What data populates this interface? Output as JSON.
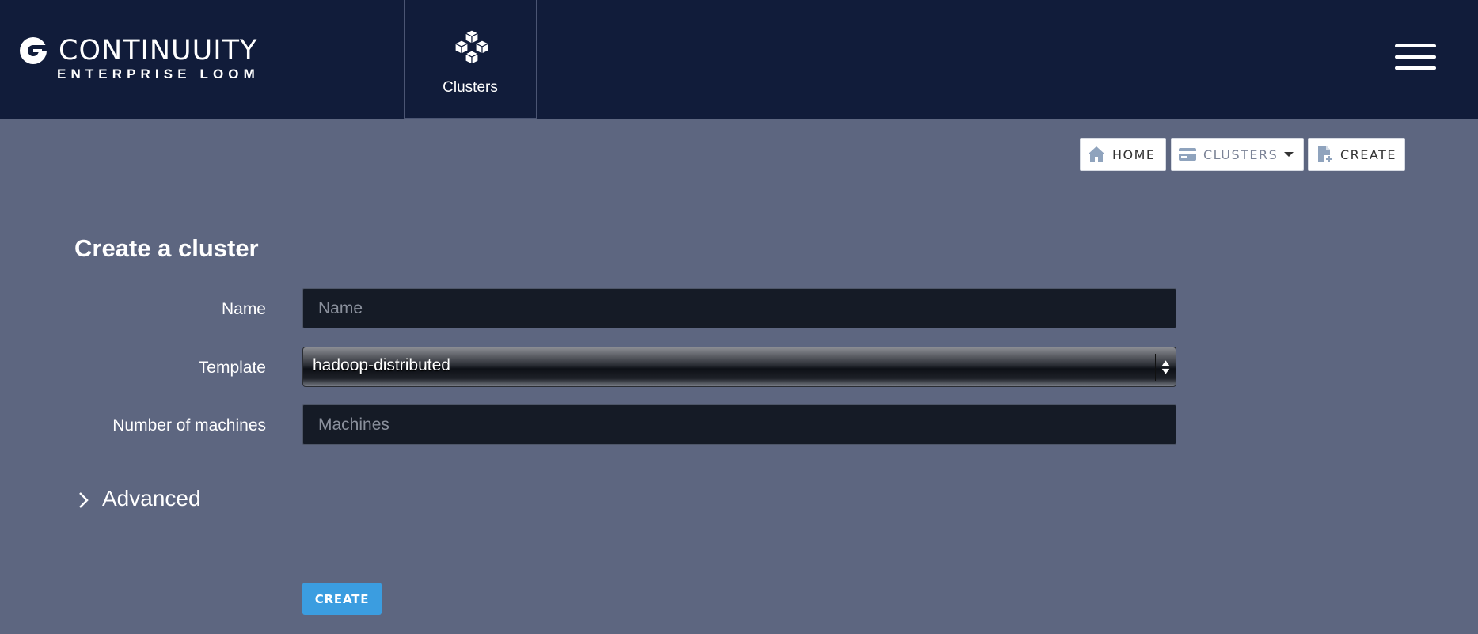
{
  "header": {
    "logo_name": "CONTINUUITY",
    "logo_subtitle": "ENTERPRISE LOOM",
    "nav_clusters_label": "Clusters",
    "menu_icon": "hamburger-menu-icon"
  },
  "breadcrumbs": {
    "home_label": "HOME",
    "home_icon": "home-icon",
    "clusters_label": "CLUSTERS",
    "clusters_icon": "card-icon",
    "clusters_dropdown_icon": "caret-down-icon",
    "create_label": "CREATE",
    "create_icon": "new-document-icon"
  },
  "form": {
    "title": "Create a cluster",
    "name_label": "Name",
    "name_placeholder": "Name",
    "name_value": "",
    "template_label": "Template",
    "template_value": "hadoop-distributed",
    "machines_label": "Number of machines",
    "machines_placeholder": "Machines",
    "machines_value": "",
    "advanced_label": "Advanced",
    "submit_label": "CREATE"
  },
  "colors": {
    "header_bg": "#111c3a",
    "page_bg": "#5d6680",
    "input_bg": "#151b26",
    "button_primary": "#3b9de0",
    "crumb_icon": "#8fa3bd"
  }
}
